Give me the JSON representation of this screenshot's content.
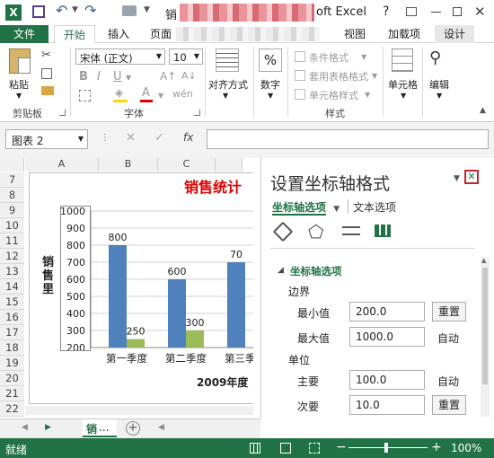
{
  "titlebar": {
    "title_left": "销",
    "title_right": "oft Excel",
    "help": "?"
  },
  "tabs": [
    "文件",
    "开始",
    "插入",
    "页面",
    "视图",
    "加载项",
    "设计"
  ],
  "ribbon": {
    "paste": "粘贴",
    "clipboard_label": "剪贴板",
    "font_name": "宋体 (正文)",
    "font_size": "10",
    "font_label": "字体",
    "bold": "B",
    "italic": "I",
    "underline": "U",
    "font_color_glyph": "A",
    "align": "对齐方式",
    "number": "数字",
    "percent": "%",
    "cond_format": "条件格式",
    "table_format": "套用表格格式",
    "cell_style": "单元格样式",
    "style_label": "样式",
    "cells": "单元格",
    "edit": "编辑"
  },
  "formula_bar": {
    "name_box": "图表 2",
    "fx": "fx"
  },
  "sheet": {
    "columns": [
      "A",
      "B",
      "C"
    ],
    "rows": [
      "7",
      "8",
      "9",
      "10",
      "11",
      "12",
      "13",
      "14",
      "15",
      "16",
      "17",
      "18",
      "19",
      "20",
      "21",
      "22"
    ]
  },
  "chart_data": {
    "type": "bar",
    "title": "销售统计",
    "categories": [
      "第一季度",
      "第二季度",
      "第三季度"
    ],
    "series": [
      {
        "values": [
          800,
          600,
          700
        ],
        "color": "#4f81bd"
      },
      {
        "values": [
          250,
          300,
          null
        ],
        "color": "#9bbb59"
      }
    ],
    "data_labels": [
      [
        "800",
        "600",
        "70"
      ],
      [
        "250",
        "300",
        ""
      ]
    ],
    "y_ticks": [
      "1000",
      "900",
      "800",
      "700",
      "600",
      "500",
      "400",
      "300",
      "200"
    ],
    "ylim": [
      200,
      1000
    ],
    "xlabel": "2009年度",
    "ylabel": "销售量",
    "ylabel_visible": "销售里"
  },
  "pane": {
    "title": "设置坐标轴格式",
    "tab_axis": "坐标轴选项",
    "tab_text": "文本选项",
    "section": "坐标轴选项",
    "bounds": "边界",
    "min_label": "最小值",
    "min_value": "200.0",
    "min_btn": "重置",
    "max_label": "最大值",
    "max_value": "1000.0",
    "max_btn": "自动",
    "units": "单位",
    "major_label": "主要",
    "major_value": "100.0",
    "major_btn": "自动",
    "minor_label": "次要",
    "minor_value": "10.0",
    "minor_btn": "重置",
    "close": "✕"
  },
  "sheet_tabs": {
    "tab": "销",
    "ellipsis": "..."
  },
  "status": {
    "ready": "就绪",
    "zoom": "100%"
  },
  "colors": {
    "excel_green": "#217346",
    "title_red": "#e00000"
  }
}
